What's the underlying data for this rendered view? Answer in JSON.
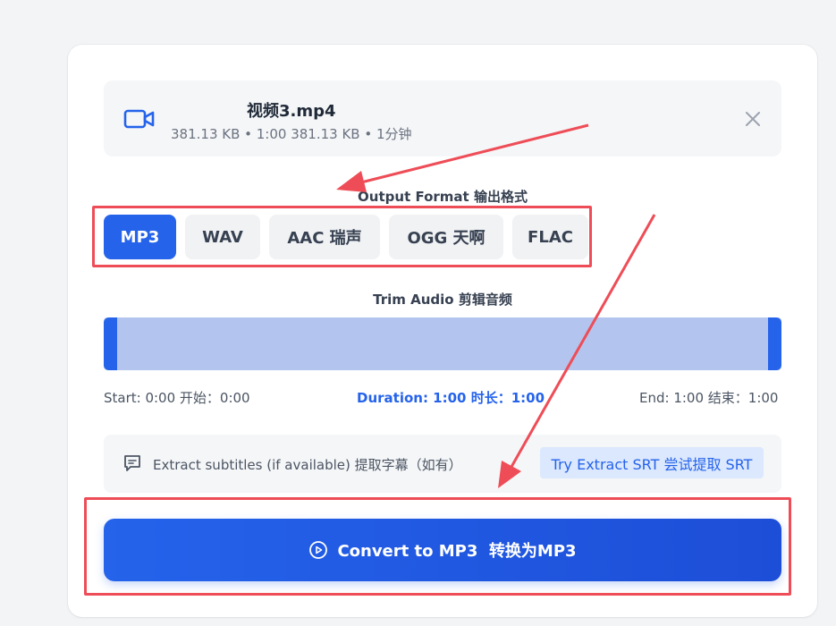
{
  "file": {
    "name": "视频3.mp4",
    "meta": "381.13 KB • 1:00 381.13 KB • 1分钟"
  },
  "output_format": {
    "label": "Output Format 输出格式",
    "options": [
      "MP3",
      "WAV",
      "AAC 瑞声",
      "OGG 天啊",
      "FLAC"
    ],
    "selected": "MP3"
  },
  "trim": {
    "label": "Trim Audio 剪辑音频",
    "start": "Start: 0:00 开始：0:00",
    "duration": "Duration: 1:00 时长：1:00",
    "end": "End: 1:00 结束：1:00"
  },
  "subtitles": {
    "text": "Extract subtitles (if available) 提取字幕（如有）",
    "button": "Try Extract SRT 尝试提取 SRT"
  },
  "convert": {
    "label": "Convert to MP3  转换为MP3"
  },
  "colors": {
    "accent": "#2563eb",
    "annotation": "#ee4d57"
  }
}
